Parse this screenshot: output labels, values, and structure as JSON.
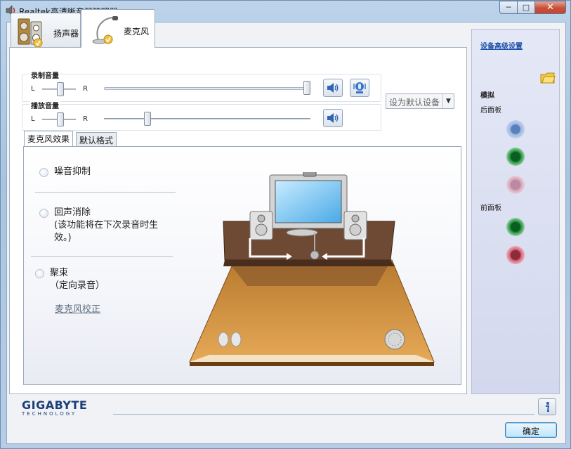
{
  "window": {
    "title": "Realtek高清晰音频管理器"
  },
  "device_tabs": [
    {
      "label": "扬声器",
      "selected": false
    },
    {
      "label": "麦克风",
      "selected": true
    }
  ],
  "recording_volume": {
    "title": "录制音量",
    "left_label": "L",
    "right_label": "R",
    "balance": 0.5,
    "level": 1.0
  },
  "playback_volume": {
    "title": "播放音量",
    "left_label": "L",
    "right_label": "R",
    "balance": 0.5,
    "level": 0.2
  },
  "default_device": {
    "label": "设为默认设备"
  },
  "sub_tabs": [
    {
      "label": "麦克风效果",
      "selected": true
    },
    {
      "label": "默认格式",
      "selected": false
    }
  ],
  "effects": {
    "noise_suppression": "噪音抑制",
    "echo_cancel": "回声消除",
    "echo_note_line1": "(该功能将在下次录音时生",
    "echo_note_line2": "效。)",
    "beam": "聚束",
    "beam_note": "（定向录音）",
    "calibrate_link": "麦克风校正"
  },
  "right_panel": {
    "advanced_link": "设备高级设置",
    "analog": "模拟",
    "rear_panel": "后面板",
    "front_panel": "前面板",
    "rear_jacks": [
      "#7f9fd0",
      "#1f8f3a",
      "#d8a6b9"
    ],
    "front_jacks": [
      "#1f8f3a",
      "#d9687c"
    ]
  },
  "brand": {
    "name": "GIGABYTE",
    "tagline": "TECHNOLOGY"
  },
  "buttons": {
    "ok": "确定",
    "minimize": "─",
    "maximize": "□",
    "close": "✕"
  }
}
